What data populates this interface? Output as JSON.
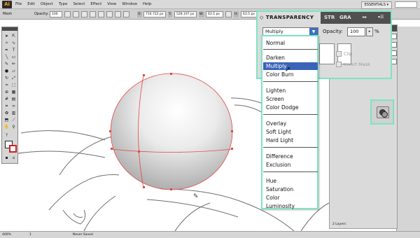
{
  "app": {
    "logo": "Ai",
    "menus": [
      "File",
      "Edit",
      "Object",
      "Type",
      "Select",
      "Effect",
      "View",
      "Window",
      "Help"
    ],
    "workspace": "ESSENTIALS ▾"
  },
  "controlbar": {
    "tool_label": "Mesh",
    "opacity_label": "Opacity:",
    "opacity_value": "100",
    "x_label": "X:",
    "x_value": "716.722 px",
    "y_label": "Y:",
    "y_value": "528.197 px",
    "w_label": "W:",
    "w_value": "63.5 px",
    "h_label": "H:",
    "h_value": "63.5 px"
  },
  "transparency_panel": {
    "tabs": [
      "TRANSPARENCY",
      "STR",
      "GRA"
    ],
    "blend_mode": "Multiply",
    "opacity_label": "Opacity:",
    "opacity_value": "100",
    "opacity_unit": "%",
    "clip_label": "Clip",
    "invert_label": "Invert Mask",
    "menu_glyph": "▸▸",
    "options_glyph": "▾☰"
  },
  "blend_list": {
    "options": [
      "Normal",
      "Darken",
      "Multiply",
      "Color Burn",
      "Lighten",
      "Screen",
      "Color Dodge",
      "Overlay",
      "Soft Light",
      "Hard Light",
      "Difference",
      "Exclusion",
      "Hue",
      "Saturation",
      "Color",
      "Luminosity"
    ],
    "selected": "Multiply"
  },
  "layers_panel": {
    "status": "2 Layers"
  },
  "statusbar": {
    "zoom": "400%",
    "page": "1",
    "status": "Never Saved"
  }
}
